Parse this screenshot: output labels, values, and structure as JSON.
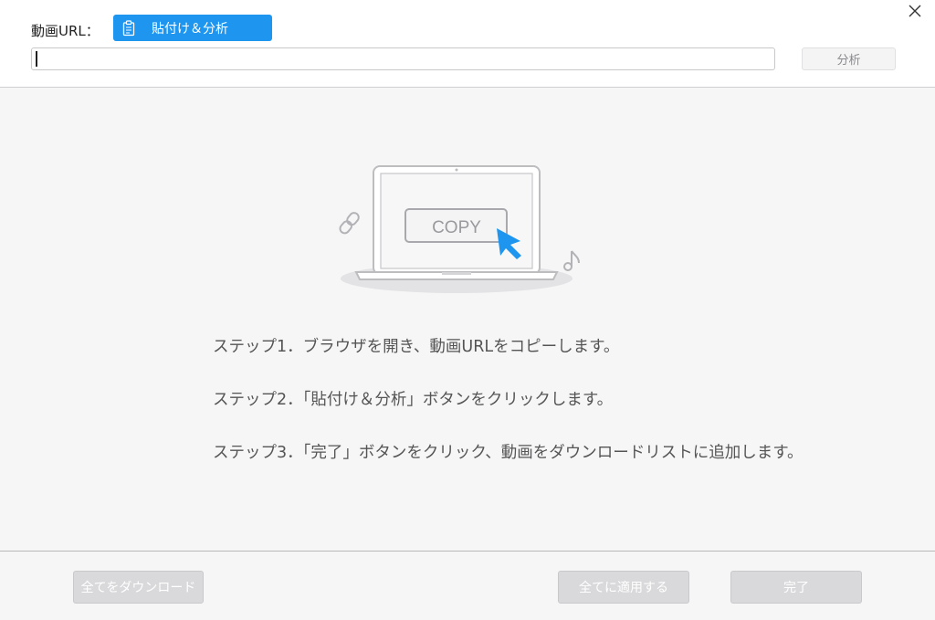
{
  "header": {
    "url_label": "動画URL：",
    "paste_button_label": "貼付け＆分析",
    "url_input_value": "",
    "analyze_button_label": "分析"
  },
  "illustration": {
    "copy_label": "COPY",
    "accent_color": "#1e96f0"
  },
  "steps": [
    {
      "text": "ステップ1．ブラウザを開き、動画URLをコピーします。"
    },
    {
      "text": "ステップ2．「貼付け＆分析」ボタンをクリックします。"
    },
    {
      "text": "ステップ3．「完了」ボタンをクリック、動画をダウンロードリストに追加します。"
    }
  ],
  "footer": {
    "download_all_label": "全てをダウンロード",
    "apply_all_label": "全てに適用する",
    "done_label": "完了"
  },
  "icons": {
    "close": "close-icon",
    "paste": "clipboard-icon",
    "link": "link-icon",
    "music": "music-note-icon",
    "cursor": "cursor-arrow-icon"
  }
}
